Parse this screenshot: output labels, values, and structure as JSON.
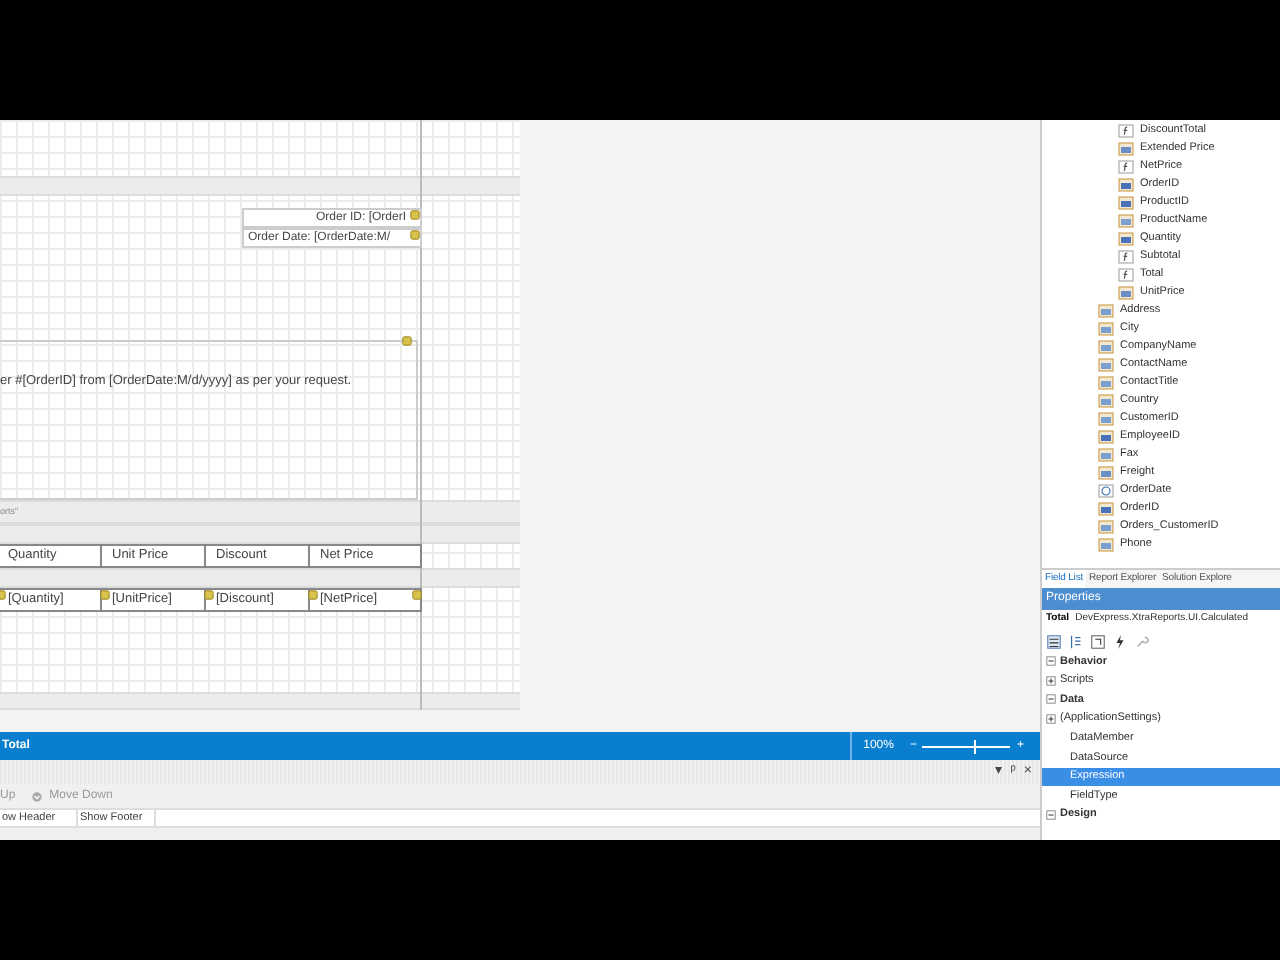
{
  "designer": {
    "header_fields": [
      "Order ID: [OrderI",
      "Order Date: [OrderDate:M/"
    ],
    "body_text": "er #[OrderID] from [OrderDate:M/d/yyyy] as per your request.",
    "band_caption": "orts\"",
    "table_header": [
      "Quantity",
      "Unit Price",
      "Discount",
      "Net Price"
    ],
    "table_detail": [
      "[Quantity]",
      "[UnitPrice]",
      "[Discount]",
      "[NetPrice]"
    ]
  },
  "field_list": {
    "nested_fields": [
      {
        "label": "DiscountTotal",
        "kind": "calculated"
      },
      {
        "label": "Extended Price",
        "kind": "decimal"
      },
      {
        "label": "NetPrice",
        "kind": "calculated"
      },
      {
        "label": "OrderID",
        "kind": "integer"
      },
      {
        "label": "ProductID",
        "kind": "integer"
      },
      {
        "label": "ProductName",
        "kind": "text"
      },
      {
        "label": "Quantity",
        "kind": "integer"
      },
      {
        "label": "Subtotal",
        "kind": "calculated"
      },
      {
        "label": "Total",
        "kind": "calculated"
      },
      {
        "label": "UnitPrice",
        "kind": "decimal"
      }
    ],
    "fields": [
      {
        "label": "Address",
        "kind": "text"
      },
      {
        "label": "City",
        "kind": "text"
      },
      {
        "label": "CompanyName",
        "kind": "text"
      },
      {
        "label": "ContactName",
        "kind": "text"
      },
      {
        "label": "ContactTitle",
        "kind": "text"
      },
      {
        "label": "Country",
        "kind": "text"
      },
      {
        "label": "CustomerID",
        "kind": "text"
      },
      {
        "label": "EmployeeID",
        "kind": "integer"
      },
      {
        "label": "Fax",
        "kind": "text"
      },
      {
        "label": "Freight",
        "kind": "decimal"
      },
      {
        "label": "OrderDate",
        "kind": "date"
      },
      {
        "label": "OrderID",
        "kind": "integer"
      },
      {
        "label": "Orders_CustomerID",
        "kind": "text"
      },
      {
        "label": "Phone",
        "kind": "text"
      }
    ]
  },
  "panel_tabs": [
    {
      "label": "Field List",
      "selected": true
    },
    {
      "label": "Report Explorer",
      "selected": false
    },
    {
      "label": "Solution Explore",
      "selected": false
    }
  ],
  "properties": {
    "title": "Properties",
    "object_name": "Total",
    "object_type": "DevExpress.XtraReports.UI.Calculated",
    "rows": [
      {
        "label": "Behavior",
        "kind": "category",
        "expanded": true,
        "selected": false
      },
      {
        "label": "Scripts",
        "kind": "group",
        "expanded": false,
        "selected": false
      },
      {
        "label": "Data",
        "kind": "category",
        "expanded": true,
        "selected": false
      },
      {
        "label": "(ApplicationSettings)",
        "kind": "group",
        "expanded": false,
        "selected": false
      },
      {
        "label": "DataMember",
        "kind": "property",
        "selected": false
      },
      {
        "label": "DataSource",
        "kind": "property",
        "selected": false
      },
      {
        "label": "Expression",
        "kind": "property",
        "selected": true
      },
      {
        "label": "FieldType",
        "kind": "property",
        "selected": false
      },
      {
        "label": "Design",
        "kind": "category",
        "expanded": true,
        "selected": false
      }
    ]
  },
  "status_bar": {
    "selection": "Total",
    "zoom": "100%",
    "zoom_minus": "−",
    "zoom_plus": "+",
    "level": 0.58
  },
  "bottom_panel": {
    "menu_glyph": "▾",
    "pin_glyph": "ᵖ",
    "close_glyph": "×",
    "toolbar": [
      "Up",
      "Move Down"
    ],
    "tabs": [
      "ow Header",
      "Show Footer"
    ]
  }
}
